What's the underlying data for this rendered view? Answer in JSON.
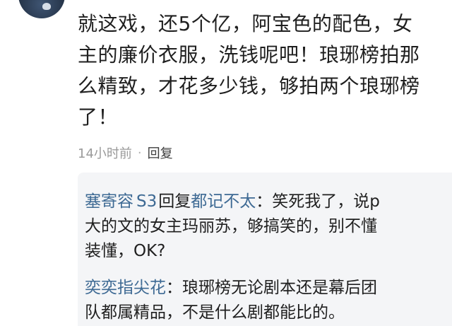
{
  "comment": {
    "lines": [
      "就这戏，还5个亿，阿宝色的配色，女",
      "主的廉价衣服，洗钱呢吧！琅琊榜拍那",
      "么精致，才花多少钱，够拍两个琅琊榜",
      "了！"
    ],
    "time": "14小时前",
    "separator": "·",
    "reply_label": "回复"
  },
  "replies": [
    {
      "user": "塞寄容",
      "badge": "S3",
      "connector": "回复",
      "target_user": "都记不太",
      "colon": "：",
      "lines": [
        "笑死我了，说p",
        "大的文的女主玛丽苏，够搞笑的，别不懂",
        "装懂，OK?"
      ]
    },
    {
      "user": "奕奕指尖花",
      "colon": "：",
      "lines": [
        "琅琊榜无论剧本还是幕后团",
        "队都属精品，不是什么剧都能比的。"
      ]
    }
  ],
  "colors": {
    "username": "#3e6a94",
    "text": "#1f1f1f",
    "meta": "#9a9a9a",
    "reply_box_bg": "#f4f5f7"
  }
}
